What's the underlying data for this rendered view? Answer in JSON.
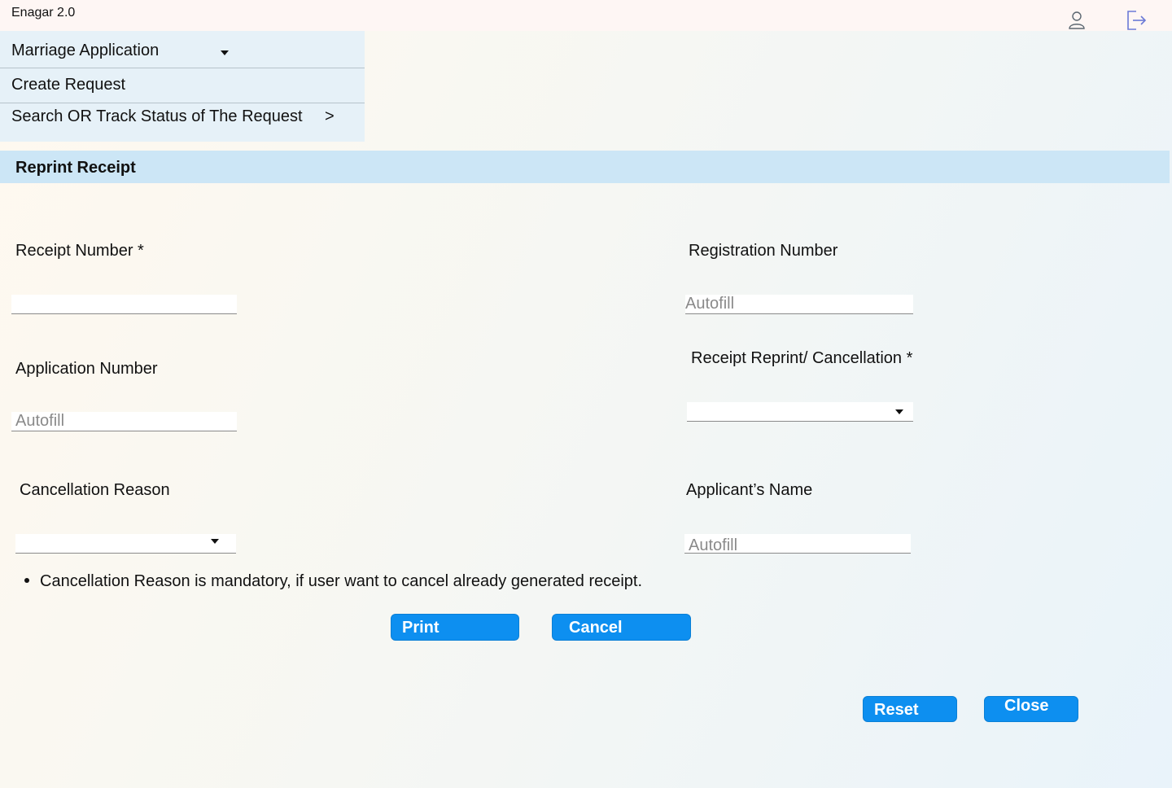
{
  "header": {
    "app_title": "Enagar 2.0",
    "user_icon": "user-icon",
    "logout_icon": "logout-icon"
  },
  "menu": {
    "items": [
      {
        "label": "Marriage Application",
        "icon": "caret-down-icon"
      },
      {
        "label": "Create Request"
      },
      {
        "label": "Search OR Track Status of The Request",
        "suffix": ">"
      }
    ]
  },
  "section": {
    "title": "Reprint Receipt"
  },
  "form": {
    "receipt_number": {
      "label": "Receipt Number *",
      "value": "",
      "placeholder": ""
    },
    "registration_number": {
      "label": "Registration Number",
      "placeholder": "Autofill"
    },
    "application_number": {
      "label": "Application Number",
      "placeholder": "Autofill"
    },
    "reprint_cancellation": {
      "label": "Receipt Reprint/ Cancellation *",
      "value": ""
    },
    "cancellation_reason": {
      "label": "Cancellation Reason",
      "value": ""
    },
    "applicant_name": {
      "label": "Applicant’s Name",
      "placeholder": "Autofill"
    }
  },
  "note": "Cancellation Reason  is mandatory, if user want to cancel  already generated receipt.",
  "buttons": {
    "print": "Print",
    "cancel": "Cancel",
    "reset": "Reset",
    "close": "Close"
  },
  "colors": {
    "primary_button": "#0d8ff0",
    "section_header_bg": "#cce6f6",
    "menu_bg": "#e6f1f8",
    "icon_accent": "#6b7ad6"
  }
}
